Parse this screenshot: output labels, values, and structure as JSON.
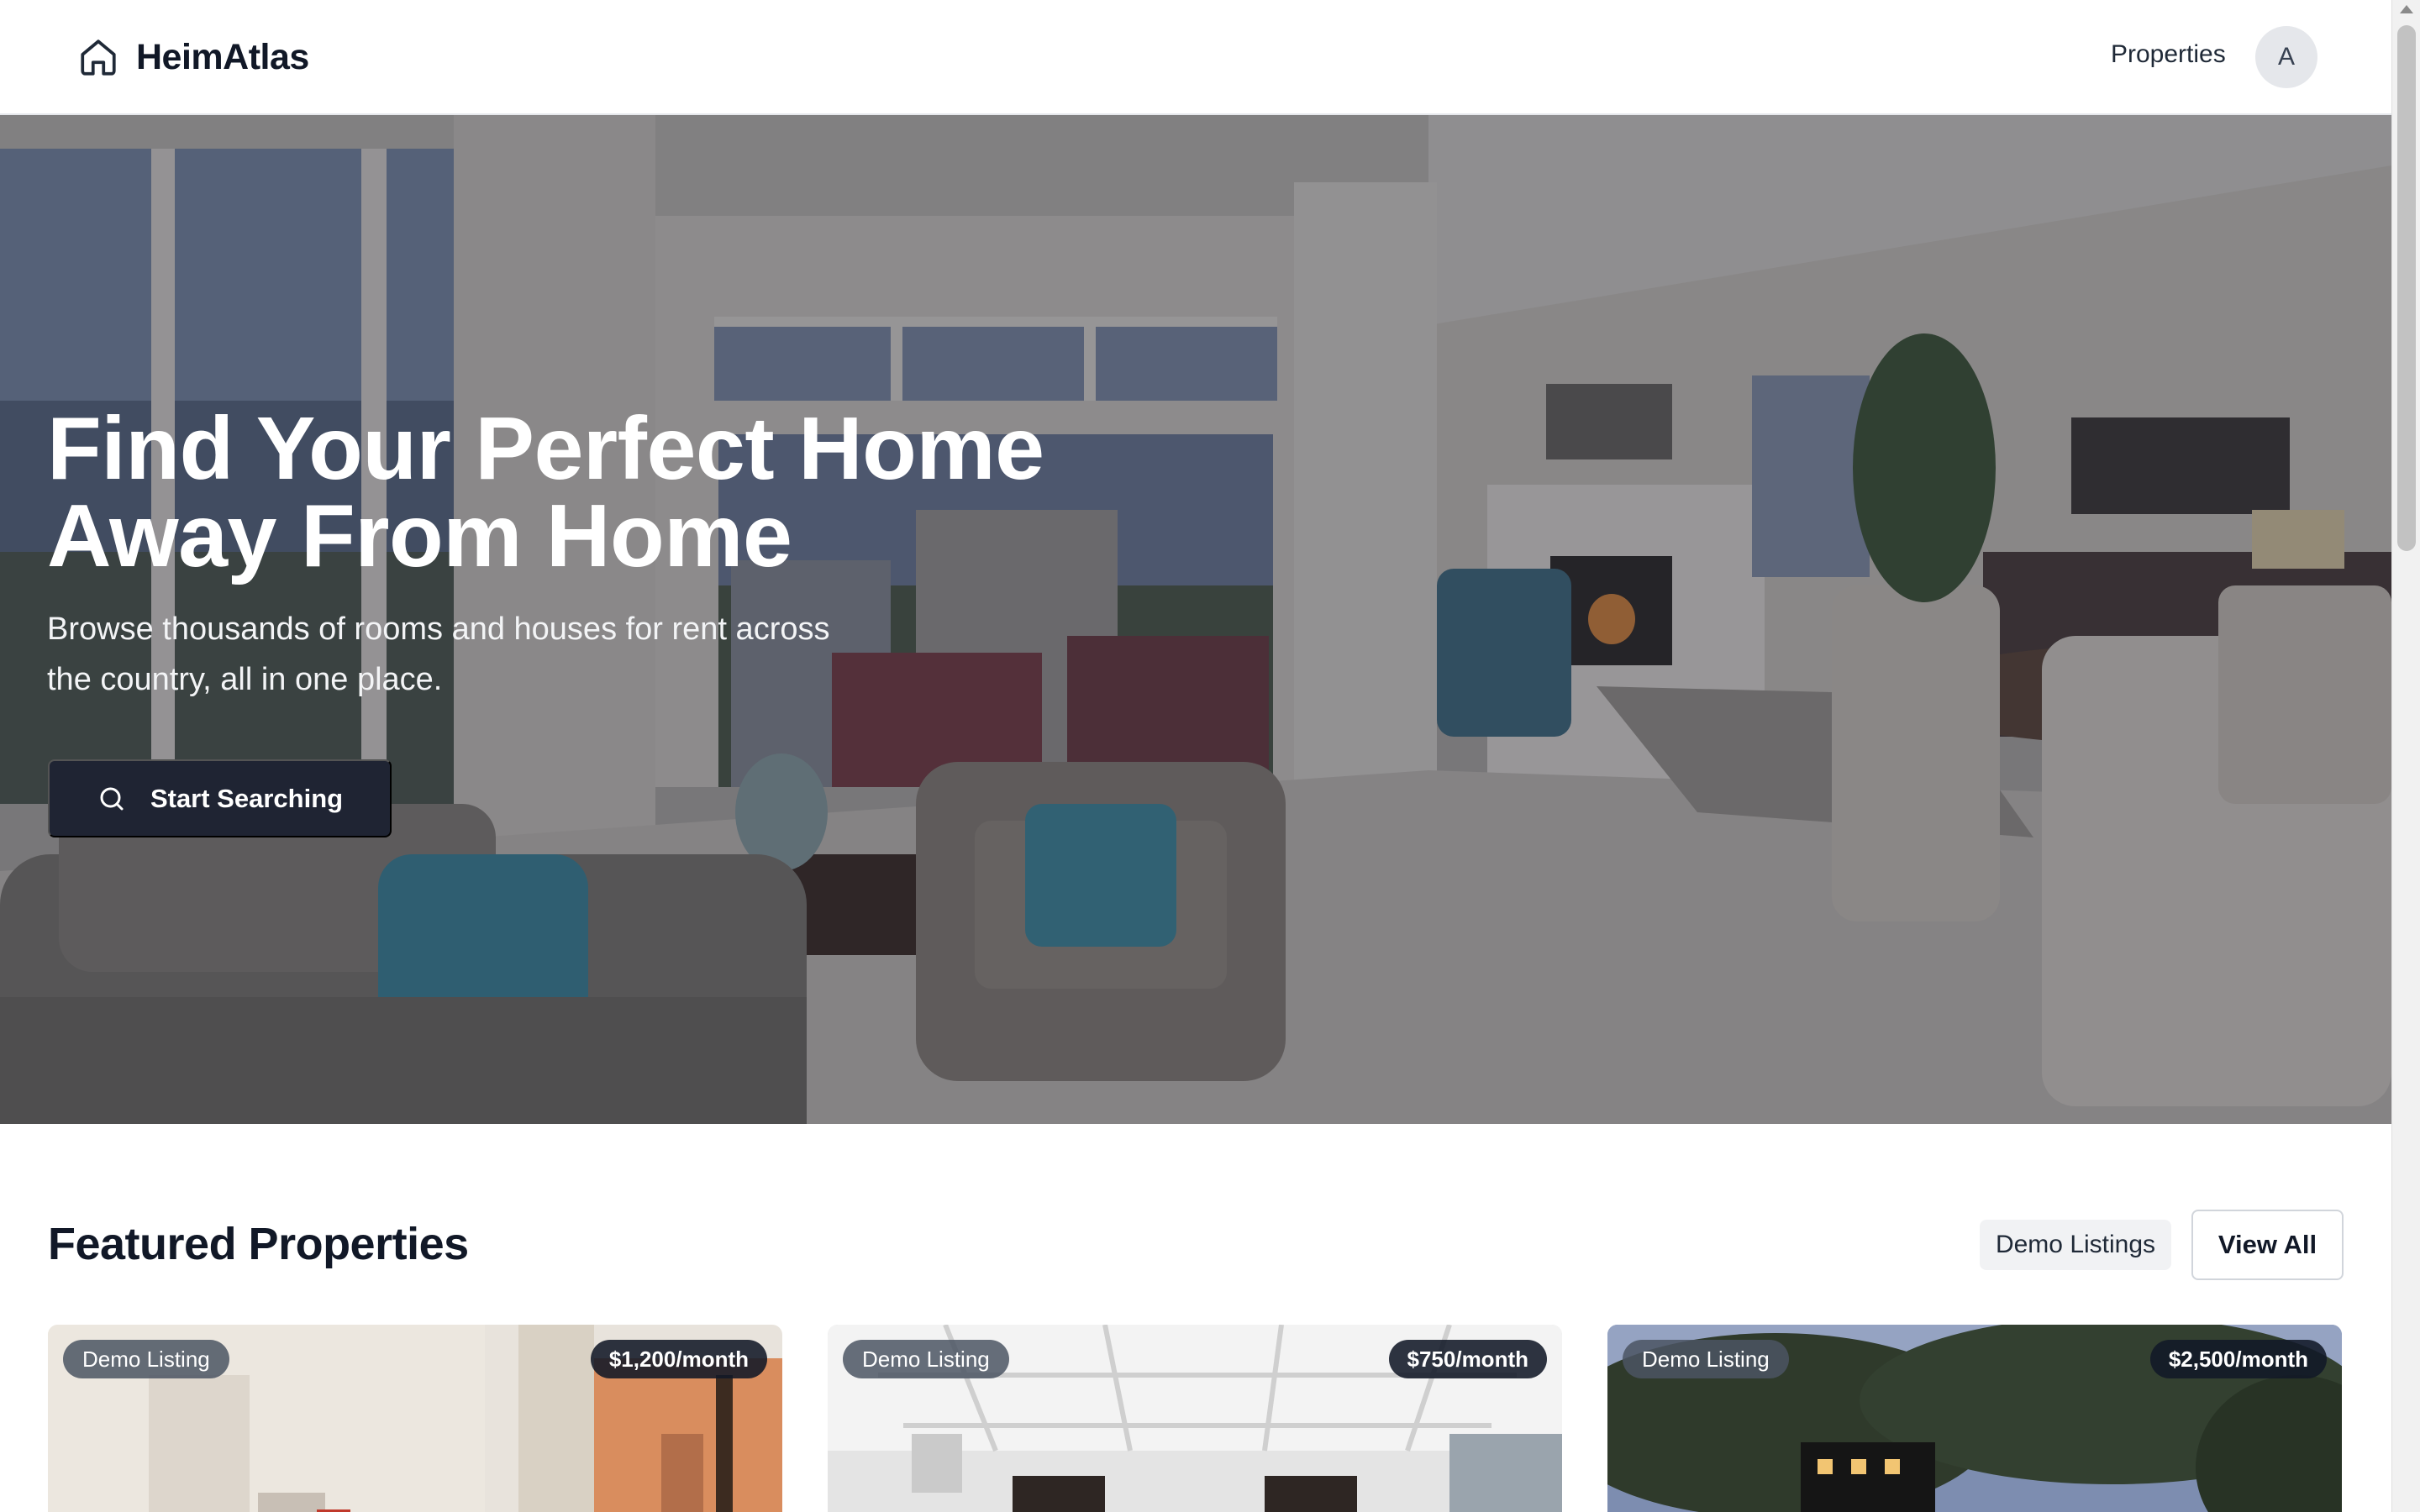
{
  "header": {
    "brand": "HeimAtlas",
    "brand_icon": "home-icon",
    "nav_properties": "Properties",
    "avatar_initial": "A"
  },
  "hero": {
    "title_line1": "Find Your Perfect Home",
    "title_line2": "Away From Home",
    "subtitle_line1": "Browse thousands of rooms and houses for rent across",
    "subtitle_line2": "the country, all in one place.",
    "cta_label": "Start Searching",
    "cta_icon": "search-icon"
  },
  "featured": {
    "title": "Featured Properties",
    "badge": "Demo Listings",
    "view_all": "View All",
    "cards": [
      {
        "tag": "Demo Listing",
        "price": "$1,200/month"
      },
      {
        "tag": "Demo Listing",
        "price": "$750/month"
      },
      {
        "tag": "Demo Listing",
        "price": "$2,500/month"
      }
    ]
  },
  "colors": {
    "primary_button": "#1f2433",
    "text_dark": "#111827",
    "price_badge": "#111827",
    "demo_badge": "#4b5563"
  }
}
